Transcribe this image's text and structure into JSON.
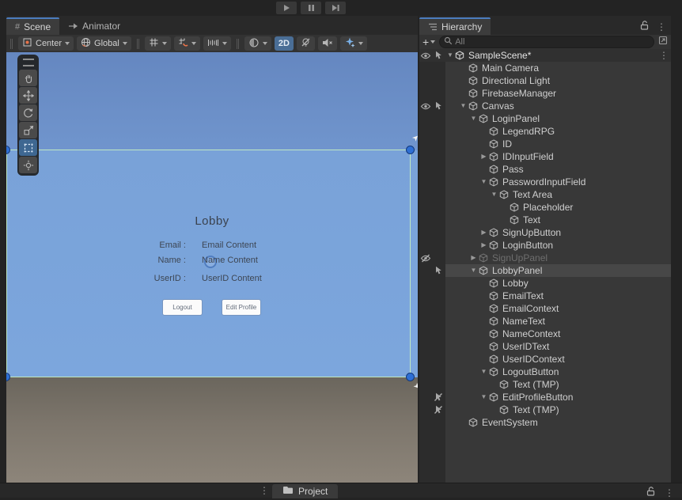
{
  "scene": {
    "tab_label": "Scene",
    "animator_tab_label": "Animator",
    "toolbar": {
      "pivot_button": "Center",
      "space_button": "Global",
      "mode_2d": "2D"
    },
    "tools": [
      "hand",
      "move",
      "rotate",
      "scale",
      "rect",
      "transform"
    ],
    "selected_tool": "rect",
    "lobby": {
      "title": "Lobby",
      "fields": [
        {
          "label": "Email :",
          "value": "Email Content"
        },
        {
          "label": "Name :",
          "value": "Name Content"
        },
        {
          "label": "UserID :",
          "value": "UserID Content"
        }
      ],
      "buttons": [
        {
          "label": "Logout"
        },
        {
          "label": "Edit Profile"
        }
      ]
    }
  },
  "hierarchy": {
    "tab_label": "Hierarchy",
    "create_label": "+",
    "search_placeholder": "All",
    "scene_row_label": "SampleScene*",
    "rows": [
      {
        "label": "Main Camera",
        "depth": 0
      },
      {
        "label": "Directional Light",
        "depth": 0
      },
      {
        "label": "FirebaseManager",
        "depth": 0
      },
      {
        "label": "Canvas",
        "depth": 0,
        "fold": "open",
        "eye": "on",
        "pick": "on"
      },
      {
        "label": "LoginPanel",
        "depth": 1,
        "fold": "open"
      },
      {
        "label": "LegendRPG",
        "depth": 2
      },
      {
        "label": "ID",
        "depth": 2
      },
      {
        "label": "IDInputField",
        "depth": 2,
        "fold": "closed"
      },
      {
        "label": "Pass",
        "depth": 2
      },
      {
        "label": "PasswordInputField",
        "depth": 2,
        "fold": "open"
      },
      {
        "label": "Text Area",
        "depth": 3,
        "fold": "open"
      },
      {
        "label": "Placeholder",
        "depth": 4
      },
      {
        "label": "Text",
        "depth": 4
      },
      {
        "label": "SignUpButton",
        "depth": 2,
        "fold": "closed"
      },
      {
        "label": "LoginButton",
        "depth": 2,
        "fold": "closed"
      },
      {
        "label": "SignUpPanel",
        "depth": 1,
        "fold": "closed",
        "dim": true,
        "eye": "off"
      },
      {
        "label": "LobbyPanel",
        "depth": 1,
        "fold": "open",
        "selected": true,
        "pick": "on"
      },
      {
        "label": "Lobby",
        "depth": 2
      },
      {
        "label": "EmailText",
        "depth": 2
      },
      {
        "label": "EmailContext",
        "depth": 2
      },
      {
        "label": "NameText",
        "depth": 2
      },
      {
        "label": "NameContext",
        "depth": 2
      },
      {
        "label": "UserIDText",
        "depth": 2
      },
      {
        "label": "UserIDContext",
        "depth": 2
      },
      {
        "label": "LogoutButton",
        "depth": 2,
        "fold": "open"
      },
      {
        "label": "Text (TMP)",
        "depth": 3
      },
      {
        "label": "EditProfileButton",
        "depth": 2,
        "fold": "open",
        "pick": "off"
      },
      {
        "label": "Text (TMP)",
        "depth": 3,
        "pick": "off"
      },
      {
        "label": "EventSystem",
        "depth": 0
      }
    ]
  },
  "project": {
    "tab_label": "Project"
  },
  "glyphs": {
    "menu_dots": "⋮",
    "fold_open": "▼",
    "fold_closed": "▶"
  },
  "colors": {
    "tab_accent": "#4c7dbf",
    "mode2d_active": "#4a6e96",
    "selection_handle": "#2e6fd4",
    "rect_edge_green": "#bfe8c2",
    "row_highlight": "#474747"
  }
}
